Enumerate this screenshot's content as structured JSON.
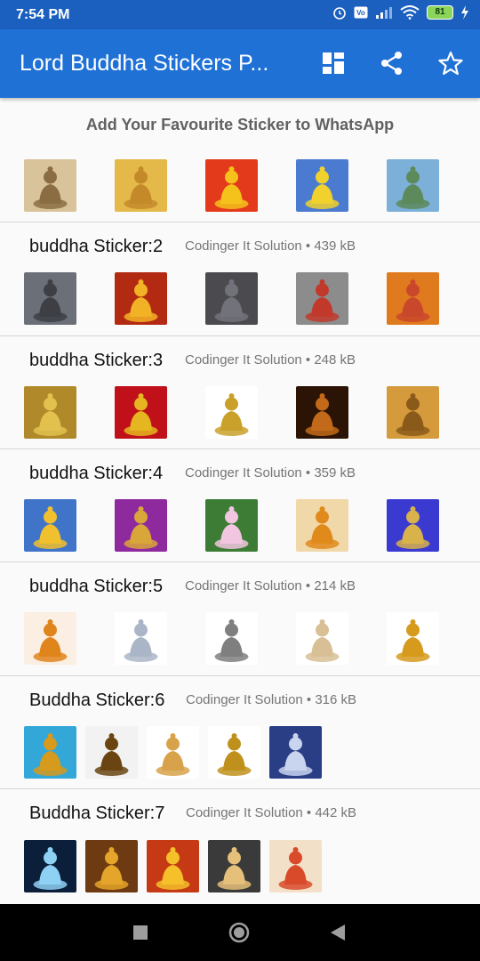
{
  "status": {
    "time": "7:54 PM",
    "battery": "81"
  },
  "appbar": {
    "title": "Lord Buddha Stickers P...",
    "icons": [
      "grid-icon",
      "share-icon",
      "star-icon"
    ]
  },
  "header": {
    "text": "Add Your Favourite Sticker to WhatsApp"
  },
  "packs": [
    {
      "name": "",
      "publisher": "",
      "size": "",
      "stickers": [
        {
          "bg": "#d9c39a",
          "fg": "#8a6d43"
        },
        {
          "bg": "#e5b84a",
          "fg": "#c48a2a"
        },
        {
          "bg": "#e43a1c",
          "fg": "#f5c21b"
        },
        {
          "bg": "#4b7bd0",
          "fg": "#f0d12e"
        },
        {
          "bg": "#7cb0d8",
          "fg": "#5d8a5b"
        }
      ]
    },
    {
      "name": "buddha Sticker:2",
      "publisher": "Codinger It Solution",
      "size": "439 kB",
      "stickers": [
        {
          "bg": "#6b6f78",
          "fg": "#3d3f45"
        },
        {
          "bg": "#b22a12",
          "fg": "#f2b226"
        },
        {
          "bg": "#4a4a4f",
          "fg": "#72727a"
        },
        {
          "bg": "#8c8c8c",
          "fg": "#c0392b"
        },
        {
          "bg": "#e07a1e",
          "fg": "#c9482b"
        }
      ]
    },
    {
      "name": "buddha Sticker:3",
      "publisher": "Codinger It Solution",
      "size": "248 kB",
      "stickers": [
        {
          "bg": "#b08a2a",
          "fg": "#e2c14f"
        },
        {
          "bg": "#c0111a",
          "fg": "#e5b61f"
        },
        {
          "bg": "#ffffff",
          "fg": "#c9a12a"
        },
        {
          "bg": "#2b1405",
          "fg": "#c26a1a"
        },
        {
          "bg": "#d49a3c",
          "fg": "#8a5a1a"
        }
      ]
    },
    {
      "name": "buddha Sticker:4",
      "publisher": "Codinger It Solution",
      "size": "359 kB",
      "stickers": [
        {
          "bg": "#3f74c9",
          "fg": "#f0c02e"
        },
        {
          "bg": "#8e2a9e",
          "fg": "#d9a63a"
        },
        {
          "bg": "#3d7c35",
          "fg": "#f2c6e0"
        },
        {
          "bg": "#f0d8a8",
          "fg": "#e08a1c"
        },
        {
          "bg": "#3a3ad0",
          "fg": "#d8b24a"
        }
      ]
    },
    {
      "name": "buddha Sticker:5",
      "publisher": "Codinger It Solution",
      "size": "214 kB",
      "stickers": [
        {
          "bg": "#fbeee2",
          "fg": "#e0841c"
        },
        {
          "bg": "#ffffff",
          "fg": "#aab6c8"
        },
        {
          "bg": "#ffffff",
          "fg": "#7f7f7f"
        },
        {
          "bg": "#ffffff",
          "fg": "#d8bf95"
        },
        {
          "bg": "#ffffff",
          "fg": "#d69a1c"
        }
      ]
    },
    {
      "name": "Buddha Sticker:6",
      "publisher": "Codinger It Solution",
      "size": "316 kB",
      "stickers": [
        {
          "bg": "#33a8d8",
          "fg": "#d69a1c"
        },
        {
          "bg": "#f2f2f2",
          "fg": "#6a4512"
        },
        {
          "bg": "#ffffff",
          "fg": "#d8a24a"
        },
        {
          "bg": "#ffffff",
          "fg": "#c0901c"
        },
        {
          "bg": "#2a3e86",
          "fg": "#c9d4ef"
        }
      ]
    },
    {
      "name": "Buddha Sticker:7",
      "publisher": "Codinger It Solution",
      "size": "442 kB",
      "stickers": [
        {
          "bg": "#0c1f3a",
          "fg": "#8fd0f5"
        },
        {
          "bg": "#6d3a12",
          "fg": "#e5a52a"
        },
        {
          "bg": "#c53a14",
          "fg": "#f5c02a"
        },
        {
          "bg": "#3a3a3a",
          "fg": "#e5c07a"
        },
        {
          "bg": "#f3e0c8",
          "fg": "#d84a2a"
        }
      ]
    }
  ]
}
